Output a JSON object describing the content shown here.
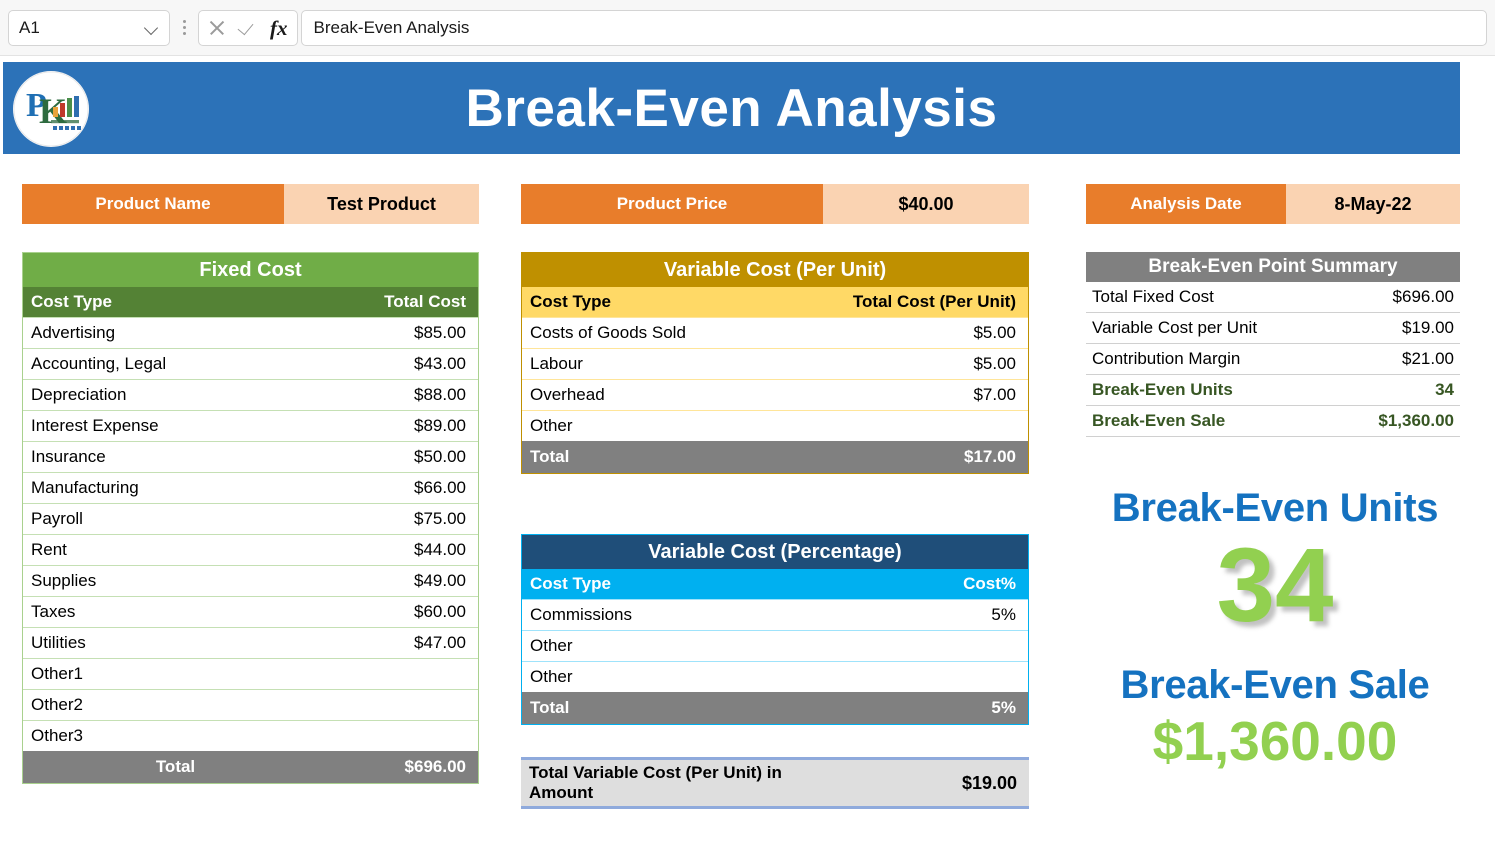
{
  "formula_bar": {
    "name_box_value": "A1",
    "cell_content": "Break-Even Analysis",
    "icons": {
      "kebab": "more-options-icon",
      "cancel": "cancel-icon",
      "enter": "confirm-icon",
      "function": "fx-icon",
      "dropdown": "chevron-down-icon"
    }
  },
  "banner": {
    "title": "Break-Even Analysis",
    "logo_alt": "pk-an-excel-expert-logo",
    "bg_color": "#2c72b8"
  },
  "labels": {
    "product_name": {
      "label": "Product Name",
      "value": "Test Product"
    },
    "product_price": {
      "label": "Product Price",
      "value": "$40.00"
    },
    "analysis_date": {
      "label": "Analysis Date",
      "value": "8-May-22"
    }
  },
  "fixed_cost": {
    "title": "Fixed Cost",
    "columns": [
      "Cost Type",
      "Total Cost"
    ],
    "rows": [
      {
        "type": "Advertising",
        "cost": "$85.00"
      },
      {
        "type": "Accounting, Legal",
        "cost": "$43.00"
      },
      {
        "type": "Depreciation",
        "cost": "$88.00"
      },
      {
        "type": "Interest Expense",
        "cost": "$89.00"
      },
      {
        "type": "Insurance",
        "cost": "$50.00"
      },
      {
        "type": "Manufacturing",
        "cost": "$66.00"
      },
      {
        "type": "Payroll",
        "cost": "$75.00"
      },
      {
        "type": "Rent",
        "cost": "$44.00"
      },
      {
        "type": "Supplies",
        "cost": "$49.00"
      },
      {
        "type": "Taxes",
        "cost": "$60.00"
      },
      {
        "type": "Utilities",
        "cost": "$47.00"
      },
      {
        "type": "Other1",
        "cost": ""
      },
      {
        "type": "Other2",
        "cost": ""
      },
      {
        "type": "Other3",
        "cost": ""
      }
    ],
    "total_label": "Total",
    "total_value": "$696.00",
    "colors": {
      "title_bg": "#70ad47",
      "header_bg": "#548235",
      "total_bg": "#808080"
    }
  },
  "variable_cost_unit": {
    "title": "Variable Cost (Per Unit)",
    "columns": [
      "Cost Type",
      "Total Cost (Per Unit)"
    ],
    "rows": [
      {
        "type": "Costs of Goods Sold",
        "cost": "$5.00"
      },
      {
        "type": "Labour",
        "cost": "$5.00"
      },
      {
        "type": "Overhead",
        "cost": "$7.00"
      },
      {
        "type": "Other",
        "cost": ""
      }
    ],
    "total_label": "Total",
    "total_value": "$17.00",
    "colors": {
      "title_bg": "#bf9000",
      "header_bg": "#ffd966",
      "total_bg": "#808080"
    }
  },
  "variable_cost_pct": {
    "title": "Variable Cost (Percentage)",
    "columns": [
      "Cost Type",
      "Cost%"
    ],
    "rows": [
      {
        "type": "Commissions",
        "cost": "5%"
      },
      {
        "type": "Other",
        "cost": ""
      },
      {
        "type": "Other",
        "cost": ""
      }
    ],
    "total_label": "Total",
    "total_value": "5%",
    "colors": {
      "title_bg": "#1f4e79",
      "header_bg": "#00b0f0",
      "total_bg": "#808080"
    }
  },
  "total_variable_cost": {
    "label": "Total Variable Cost (Per Unit) in Amount",
    "value": "$19.00"
  },
  "summary": {
    "title": "Break-Even Point Summary",
    "rows": [
      {
        "key": "Total Fixed Cost",
        "value": "$696.00",
        "highlight": false
      },
      {
        "key": "Variable Cost per Unit",
        "value": "$19.00",
        "highlight": false
      },
      {
        "key": "Contribution Margin",
        "value": "$21.00",
        "highlight": false
      },
      {
        "key": "Break-Even Units",
        "value": "34",
        "highlight": true
      },
      {
        "key": "Break-Even Sale",
        "value": "$1,360.00",
        "highlight": true
      }
    ]
  },
  "kpi": {
    "units_label": "Break-Even Units",
    "units_value": "34",
    "sale_label": "Break-Even Sale",
    "sale_value": "$1,360.00",
    "label_color": "#1572c0",
    "value_color": "#92d050"
  }
}
